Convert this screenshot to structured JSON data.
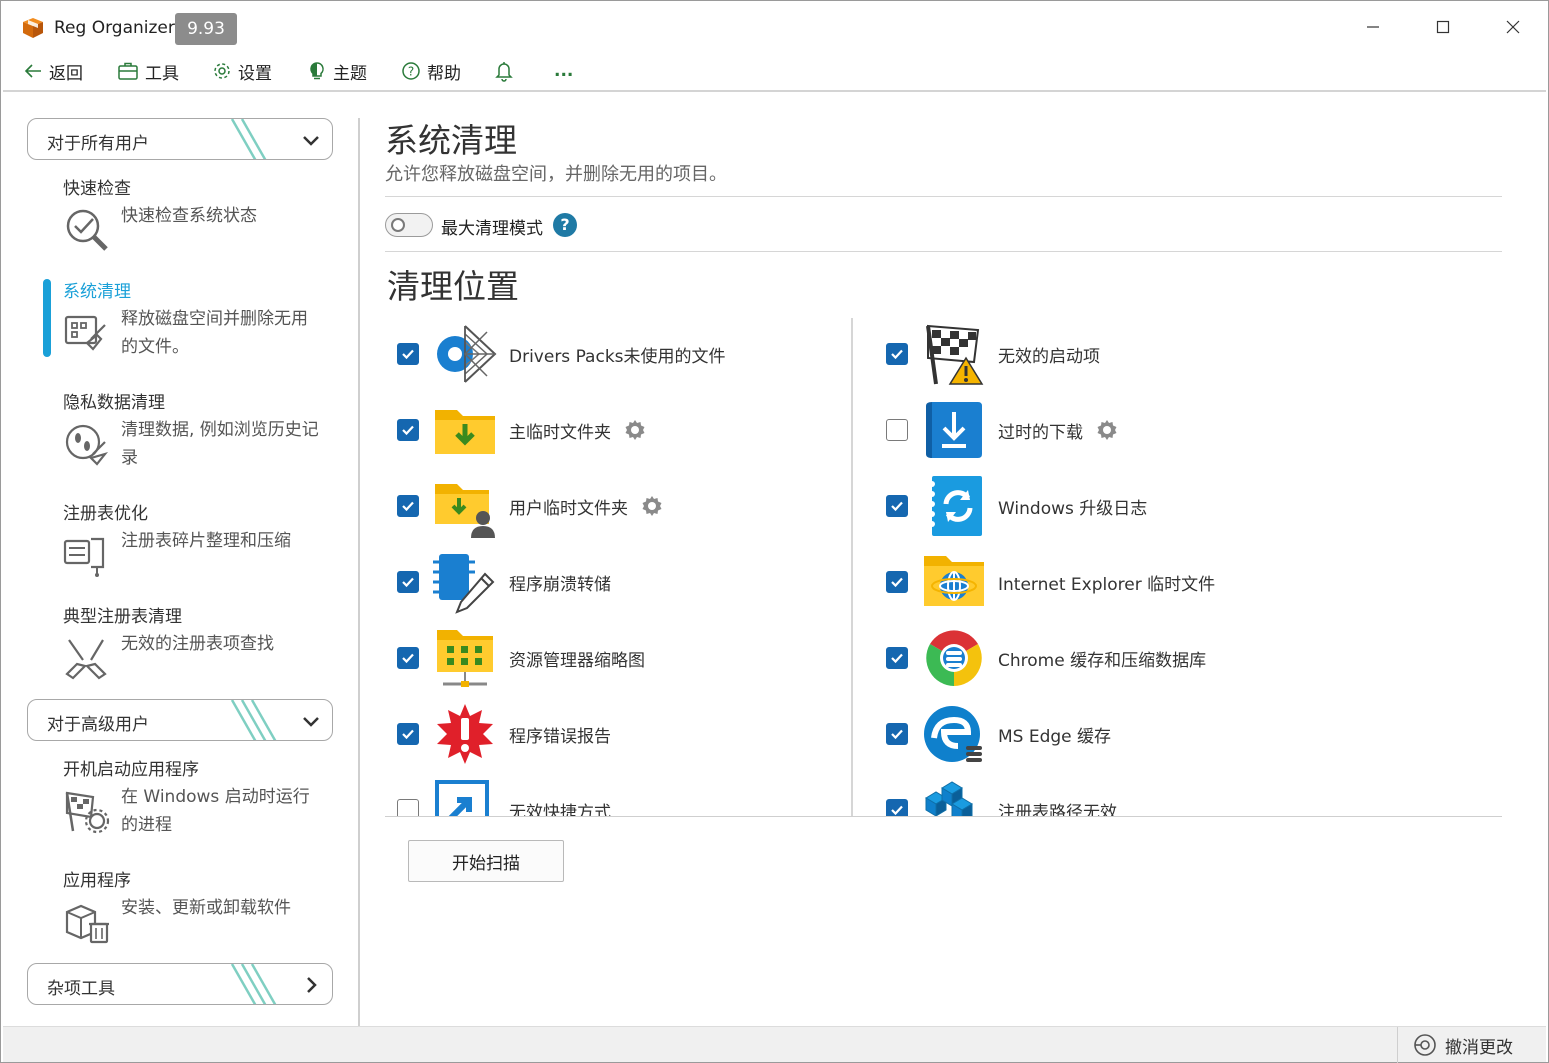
{
  "app": {
    "title": "Reg Organizer",
    "version": "9.93"
  },
  "menu": {
    "back": "返回",
    "tools": "工具",
    "settings": "设置",
    "theme": "主题",
    "help": "帮助",
    "more": "..."
  },
  "sidebar": {
    "section_all_users": "对于所有用户",
    "section_advanced": "对于高级用户",
    "section_misc": "杂项工具",
    "items": [
      {
        "title": "快速检查",
        "desc": "快速检查系统状态"
      },
      {
        "title": "系统清理",
        "desc": "释放磁盘空间并删除无用的文件。"
      },
      {
        "title": "隐私数据清理",
        "desc": "清理数据, 例如浏览历史记录"
      },
      {
        "title": "注册表优化",
        "desc": "注册表碎片整理和压缩"
      },
      {
        "title": "典型注册表清理",
        "desc": "无效的注册表项查找"
      },
      {
        "title": "开机启动应用程序",
        "desc": "在 Windows 启动时运行的进程"
      },
      {
        "title": "应用程序",
        "desc": "安装、更新或卸载软件"
      }
    ]
  },
  "main": {
    "title": "系统清理",
    "subtitle": "允许您释放磁盘空间，并删除无用的项目。",
    "max_mode_label": "最大清理模式",
    "max_mode_on": false,
    "help_glyph": "?",
    "locations_title": "清理位置",
    "left_items": [
      {
        "label": "Drivers Packs未使用的文件",
        "checked": true,
        "icon": "drivers-packs-icon",
        "gear": false
      },
      {
        "label": "主临时文件夹",
        "checked": true,
        "icon": "temp-folder-icon",
        "gear": true
      },
      {
        "label": "用户临时文件夹",
        "checked": true,
        "icon": "user-temp-folder-icon",
        "gear": true
      },
      {
        "label": "程序崩溃转储",
        "checked": true,
        "icon": "crash-dump-icon",
        "gear": false
      },
      {
        "label": "资源管理器缩略图",
        "checked": true,
        "icon": "thumbnails-icon",
        "gear": false
      },
      {
        "label": "程序错误报告",
        "checked": true,
        "icon": "error-report-icon",
        "gear": false
      },
      {
        "label": "无效快捷方式",
        "checked": false,
        "icon": "shortcut-icon",
        "gear": false
      }
    ],
    "right_items": [
      {
        "label": "无效的启动项",
        "checked": true,
        "icon": "startup-flag-icon",
        "gear": false
      },
      {
        "label": "过时的下载",
        "checked": false,
        "icon": "downloads-icon",
        "gear": true
      },
      {
        "label": "Windows 升级日志",
        "checked": true,
        "icon": "windows-update-log-icon",
        "gear": false
      },
      {
        "label": "Internet Explorer 临时文件",
        "checked": true,
        "icon": "ie-temp-icon",
        "gear": false
      },
      {
        "label": "Chrome 缓存和压缩数据库",
        "checked": true,
        "icon": "chrome-icon",
        "gear": false
      },
      {
        "label": "MS Edge 缓存",
        "checked": true,
        "icon": "edge-icon",
        "gear": false
      },
      {
        "label": "注册表路径无效",
        "checked": true,
        "icon": "registry-path-icon",
        "gear": false
      }
    ],
    "scan_button": "开始扫描"
  },
  "status": {
    "undo": "撤消更改"
  },
  "colors": {
    "accent": "#1aa0d8",
    "checkbox": "#1567b0"
  }
}
